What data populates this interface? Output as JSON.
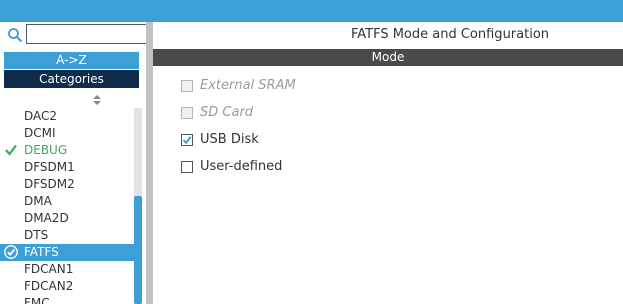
{
  "search": {
    "placeholder": "",
    "value": ""
  },
  "buttons": {
    "az": "A->Z",
    "categories": "Categories"
  },
  "list": {
    "items": [
      {
        "label": "DAC2",
        "status": "none"
      },
      {
        "label": "DCMI",
        "status": "none"
      },
      {
        "label": "DEBUG",
        "status": "configured"
      },
      {
        "label": "DFSDM1",
        "status": "none"
      },
      {
        "label": "DFSDM2",
        "status": "none"
      },
      {
        "label": "DMA",
        "status": "none"
      },
      {
        "label": "DMA2D",
        "status": "none"
      },
      {
        "label": "DTS",
        "status": "none"
      },
      {
        "label": "FATFS",
        "status": "selected-configured"
      },
      {
        "label": "FDCAN1",
        "status": "none"
      },
      {
        "label": "FDCAN2",
        "status": "none"
      },
      {
        "label": "FMC",
        "status": "none"
      }
    ]
  },
  "config": {
    "title": "FATFS Mode and Configuration",
    "mode_header": "Mode",
    "options": [
      {
        "label": "External SRAM",
        "checked": false,
        "enabled": false
      },
      {
        "label": "SD Card",
        "checked": false,
        "enabled": false
      },
      {
        "label": "USB Disk",
        "checked": true,
        "enabled": true
      },
      {
        "label": "User-defined",
        "checked": false,
        "enabled": true
      }
    ]
  },
  "colors": {
    "accent": "#3c9fd6",
    "dark_header": "#102b4c",
    "mode_bar": "#4a4a4a",
    "ok_green": "#3aaa5a"
  }
}
